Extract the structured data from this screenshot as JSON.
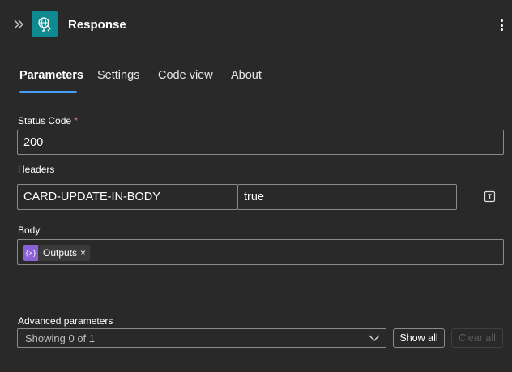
{
  "header": {
    "title": "Response",
    "collapse_icon": "double-chevron-right-icon",
    "app_icon": "response-globe-icon",
    "app_icon_color": "#0f8a91",
    "more_icon": "more-vertical-icon"
  },
  "tabs": [
    {
      "label": "Parameters",
      "active": true
    },
    {
      "label": "Settings",
      "active": false
    },
    {
      "label": "Code view",
      "active": false
    },
    {
      "label": "About",
      "active": false
    }
  ],
  "status_code": {
    "label": "Status Code",
    "required_marker": "*",
    "value": "200"
  },
  "headers": {
    "label": "Headers",
    "key": "CARD-UPDATE-IN-BODY",
    "value": "true",
    "mode_icon": "text-mode-switch-icon"
  },
  "body": {
    "label": "Body",
    "token": {
      "icon": "{x}",
      "label": "Outputs",
      "remove": "×",
      "color": "#8b61d6"
    }
  },
  "advanced": {
    "label": "Advanced parameters",
    "select_value": "Showing 0 of 1",
    "show_all": "Show all",
    "clear_all": "Clear all"
  },
  "colors": {
    "background": "#292929",
    "accent": "#479ef5",
    "required": "#e37d80"
  }
}
